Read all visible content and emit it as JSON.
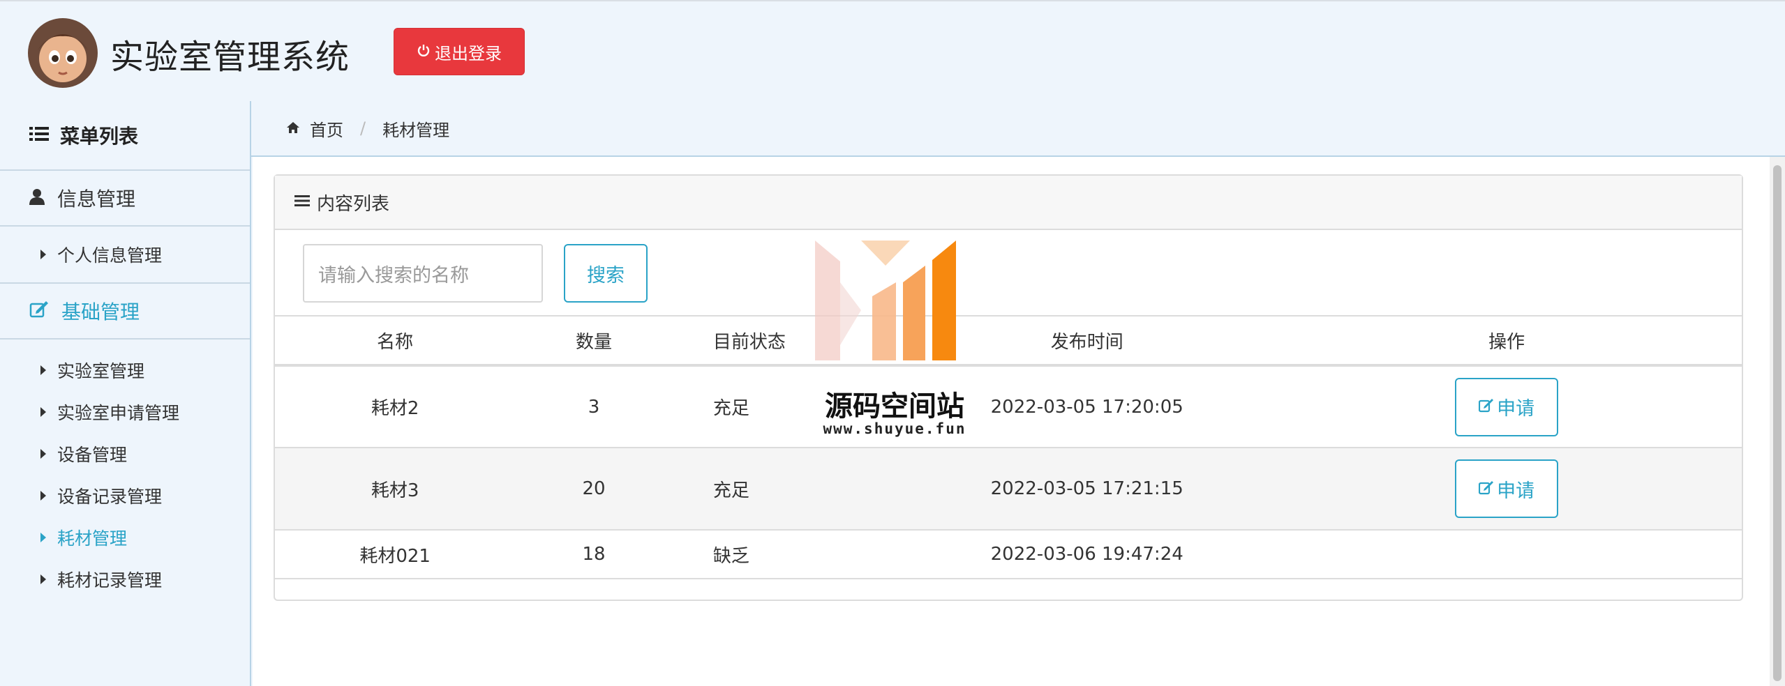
{
  "header": {
    "title": "实验室管理系统",
    "logout_label": "退出登录"
  },
  "sidebar": {
    "title": "菜单列表",
    "groups": [
      {
        "label": "信息管理",
        "items": [
          {
            "label": "个人信息管理"
          }
        ]
      },
      {
        "label": "基础管理",
        "items": [
          {
            "label": "实验室管理"
          },
          {
            "label": "实验室申请管理"
          },
          {
            "label": "设备管理"
          },
          {
            "label": "设备记录管理"
          },
          {
            "label": "耗材管理"
          },
          {
            "label": "耗材记录管理"
          }
        ]
      }
    ]
  },
  "breadcrumb": {
    "home": "首页",
    "current": "耗材管理"
  },
  "panel": {
    "title": "内容列表",
    "search": {
      "placeholder": "请输入搜索的名称",
      "button": "搜索"
    },
    "columns": [
      "名称",
      "数量",
      "目前状态",
      "发布时间",
      "操作"
    ],
    "rows": [
      {
        "name": "耗材2",
        "qty": "3",
        "status": "充足",
        "time": "2022-03-05 17:20:05",
        "action": "申请"
      },
      {
        "name": "耗材3",
        "qty": "20",
        "status": "充足",
        "time": "2022-03-05 17:21:15",
        "action": "申请"
      },
      {
        "name": "耗材021",
        "qty": "18",
        "status": "缺乏",
        "time": "2022-03-06 19:47:24"
      }
    ]
  },
  "watermark": {
    "text": "源码空间站",
    "url": "www.shuyue.fun"
  },
  "colors": {
    "accent": "#2aa3c7",
    "danger": "#e8383d",
    "background": "#eef5fc"
  }
}
